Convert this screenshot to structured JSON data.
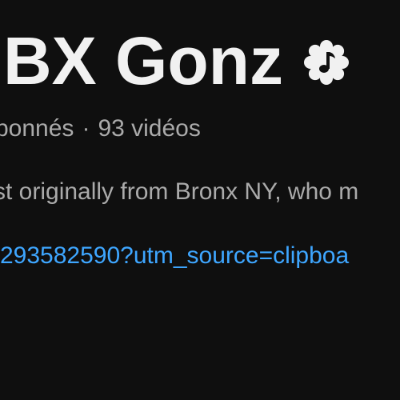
{
  "channel": {
    "name": "BX Gonz",
    "badge_icon": "music-note-verified-icon",
    "subscribers_text": "bonnés",
    "separator": "·",
    "videos_text": "93 vidéos",
    "description": "st originally from Bronx NY, who m",
    "link": "-293582590?utm_source=clipboa"
  },
  "colors": {
    "background": "#0f0f0f",
    "title": "#f1f1f1",
    "secondary_text": "#aaaaaa",
    "link": "#3ea6ff"
  }
}
